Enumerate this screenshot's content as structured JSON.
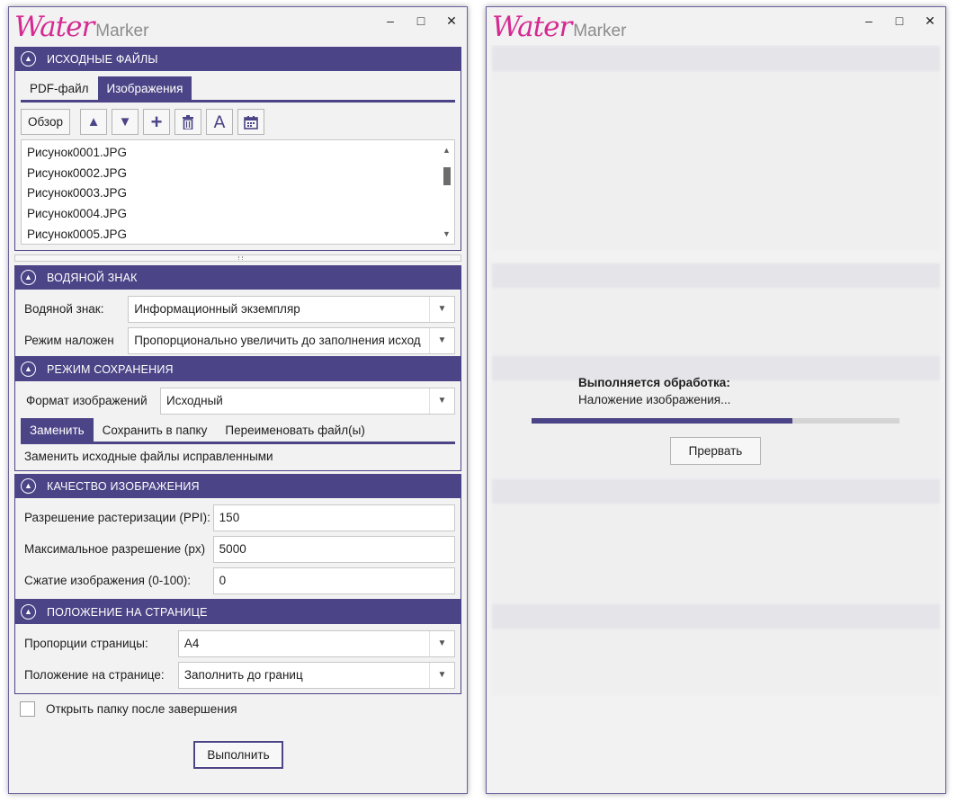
{
  "app": {
    "logo_water": "Water",
    "logo_marker": "Marker"
  },
  "window_controls": {
    "minimize": "–",
    "maximize": "□",
    "close": "✕"
  },
  "sections": {
    "source": {
      "title": "ИСХОДНЫЕ ФАЙЛЫ",
      "tabs": [
        "PDF-файл",
        "Изображения"
      ],
      "active_tab": "Изображения",
      "browse_label": "Обзор",
      "toolbar_icons": [
        "arrow-up-icon",
        "arrow-down-icon",
        "add-icon",
        "delete-icon",
        "text-icon",
        "calendar-icon"
      ],
      "files": [
        "Рисунок0001.JPG",
        "Рисунок0002.JPG",
        "Рисунок0003.JPG",
        "Рисунок0004.JPG",
        "Рисунок0005.JPG"
      ]
    },
    "watermark": {
      "title": "ВОДЯНОЙ ЗНАК",
      "watermark_label": "Водяной знак:",
      "watermark_value": "Информационный экземпляр",
      "overlay_label": "Режим наложен",
      "overlay_value": "Пропорционально увеличить до заполнения исход"
    },
    "save_mode": {
      "title": "РЕЖИМ СОХРАНЕНИЯ",
      "format_label": "Формат изображений",
      "format_value": "Исходный",
      "tabs": [
        "Заменить",
        "Сохранить в папку",
        "Переименовать файл(ы)"
      ],
      "active_tab": "Заменить",
      "description": "Заменить исходные файлы исправленными"
    },
    "quality": {
      "title": "КАЧЕСТВО ИЗОБРАЖЕНИЯ",
      "raster_label": "Разрешение растеризации (PPI):",
      "raster_value": "150",
      "maxres_label": "Максимальное разрешение (px)",
      "maxres_value": "5000",
      "compress_label": "Сжатие изображения (0-100):",
      "compress_value": "0"
    },
    "position": {
      "title": "ПОЛОЖЕНИЕ НА СТРАНИЦЕ",
      "proportions_label": "Пропорции страницы:",
      "proportions_value": "A4",
      "placement_label": "Положение на странице:",
      "placement_value": "Заполнить до границ"
    }
  },
  "open_folder_label": "Открыть папку после завершения",
  "open_folder_checked": false,
  "run_label": "Выполнить",
  "progress": {
    "title": "Выполняется обработка:",
    "status": "Наложение изображения...",
    "fraction": 0.71,
    "abort_label": "Прервать"
  },
  "colors": {
    "accent": "#4b4486",
    "logo_pink": "#d42a92",
    "background": "#f2f2f2"
  }
}
